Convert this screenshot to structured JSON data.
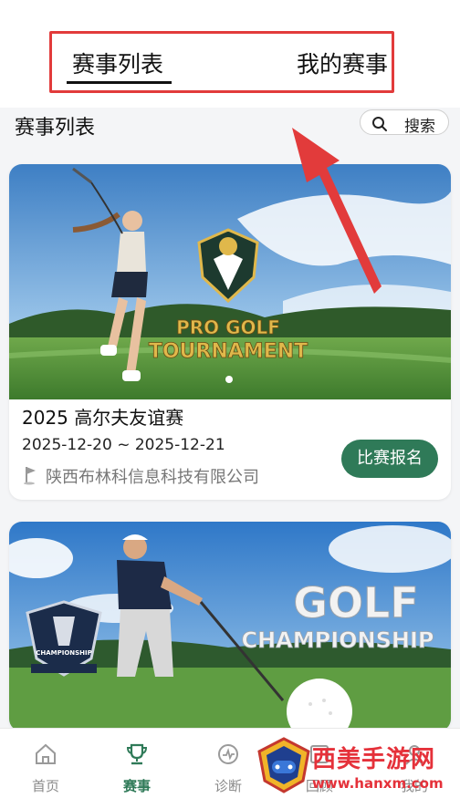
{
  "tabs": {
    "list_label": "赛事列表",
    "mine_label": "我的赛事"
  },
  "section": {
    "title": "赛事列表",
    "search_label": "搜索"
  },
  "events": [
    {
      "hero_line1": "PRO GOLF",
      "hero_line2": "TOURNAMENT",
      "title": "2025 高尔夫友谊赛",
      "dates": "2025-12-20 ~ 2025-12-21",
      "organizer": "陕西布林科信息科技有限公司",
      "register_label": "比赛报名"
    },
    {
      "hero_line1": "GOLF",
      "hero_line2": "CHAMPIONSHIP",
      "badge_text": "CHAMPIONSHIP"
    }
  ],
  "bottom_nav": [
    {
      "label": "首页",
      "icon": "home-icon"
    },
    {
      "label": "赛事",
      "icon": "trophy-icon"
    },
    {
      "label": "诊断",
      "icon": "diagnose-icon"
    },
    {
      "label": "回顾",
      "icon": "review-icon"
    },
    {
      "label": "我的",
      "icon": "profile-icon"
    }
  ],
  "watermark": {
    "name": "西美手游网",
    "url": "www.hanxm.com"
  },
  "colors": {
    "accent": "#2f7a58",
    "annotation": "#e23b3b"
  }
}
